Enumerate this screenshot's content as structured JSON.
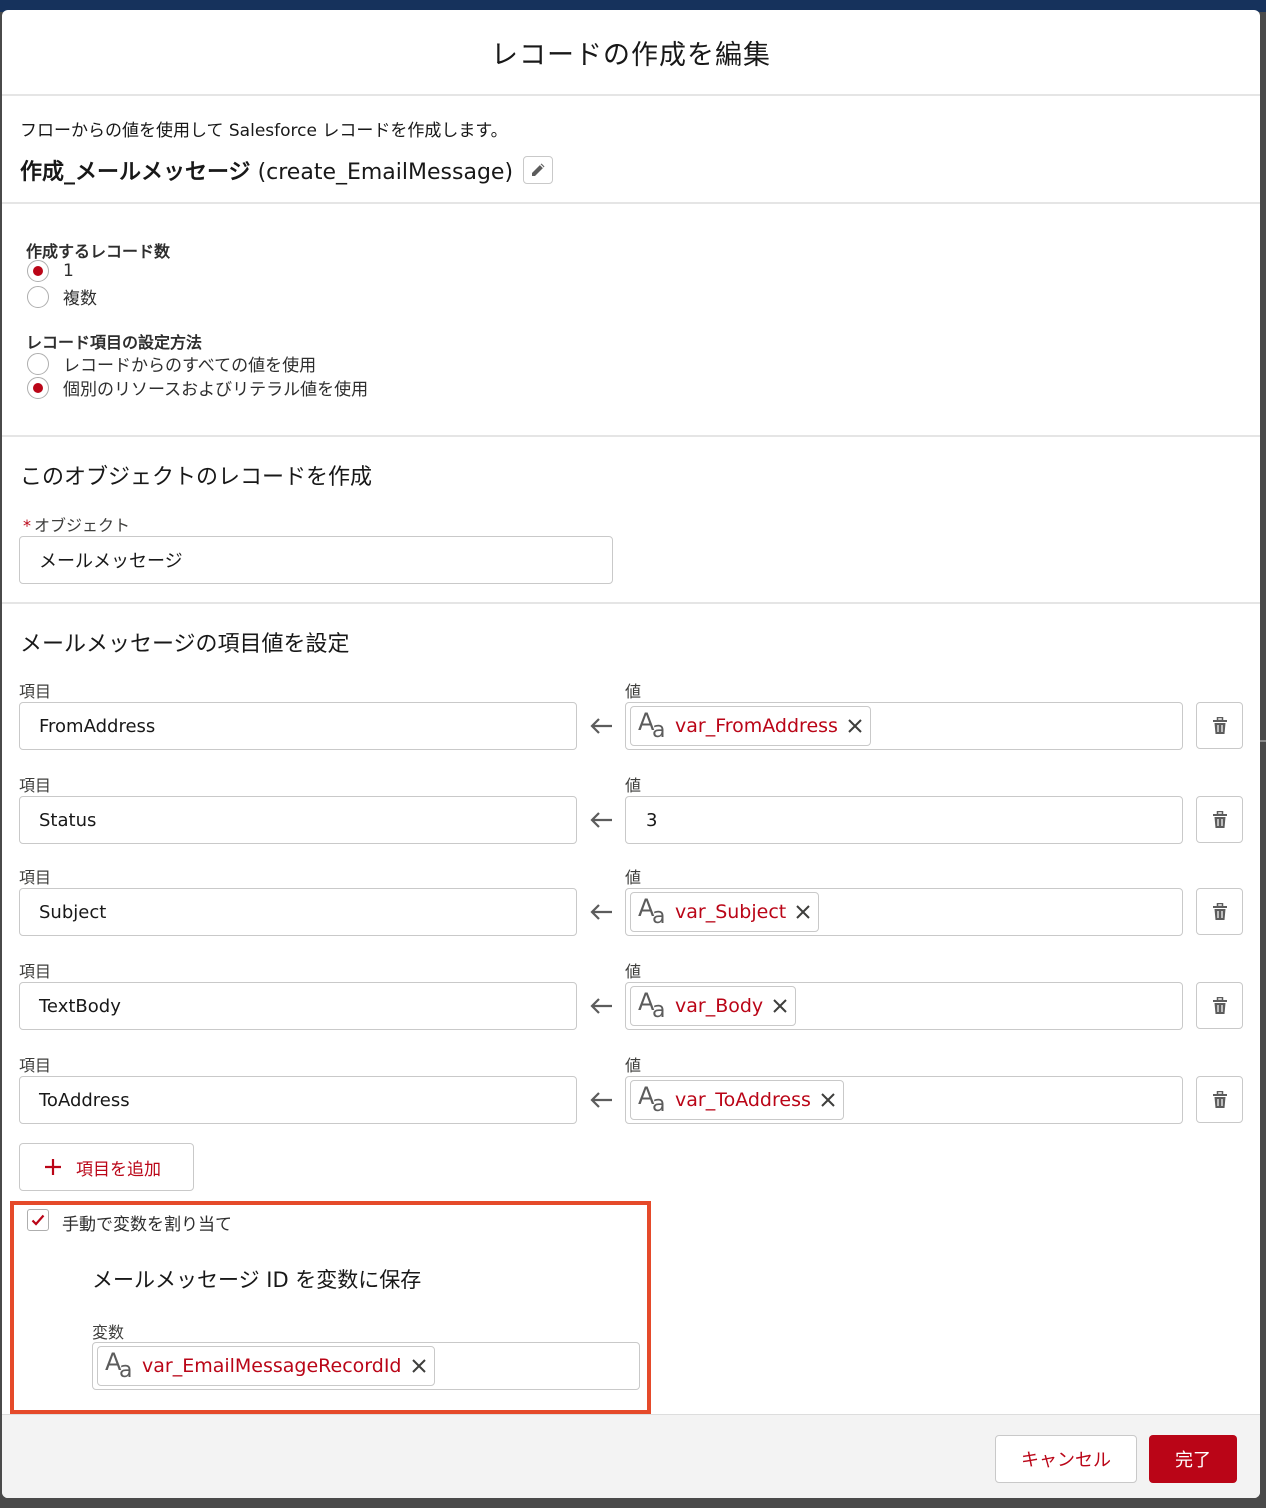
{
  "modal": {
    "title": "レコードの作成を編集"
  },
  "description": {
    "text": "フローからの値を使用して Salesforce レコードを作成します。",
    "element_label": "作成_メールメッセージ",
    "api_name": "(create_EmailMessage)"
  },
  "record_count": {
    "label": "作成するレコード数",
    "options": [
      {
        "label": "1",
        "checked": true
      },
      {
        "label": "複数",
        "checked": false
      }
    ]
  },
  "field_method": {
    "label": "レコード項目の設定方法",
    "options": [
      {
        "label": "レコードからのすべての値を使用",
        "checked": false
      },
      {
        "label": "個別のリソースおよびリテラル値を使用",
        "checked": true
      }
    ]
  },
  "object_section": {
    "heading": "このオブジェクトのレコードを作成",
    "required_mark": "*",
    "object_label": "オブジェクト",
    "object_value": "メールメッセージ"
  },
  "values_section": {
    "heading": "メールメッセージの項目値を設定",
    "field_label": "項目",
    "value_label": "値",
    "rows": [
      {
        "field": "FromAddress",
        "value": "var_FromAddress",
        "value_type": "resource"
      },
      {
        "field": "Status",
        "value": "3",
        "value_type": "literal"
      },
      {
        "field": "Subject",
        "value": "var_Subject",
        "value_type": "resource"
      },
      {
        "field": "TextBody",
        "value": "var_Body",
        "value_type": "resource"
      },
      {
        "field": "ToAddress",
        "value": "var_ToAddress",
        "value_type": "resource"
      }
    ],
    "add_button_label": "項目を追加"
  },
  "manual_assign": {
    "checkbox_label": "手動で変数を割り当て",
    "checked": true,
    "store_heading": "メールメッセージ ID を変数に保存",
    "variable_label": "変数",
    "variable_value": "var_EmailMessageRecordId"
  },
  "footer": {
    "cancel_label": "キャンセル",
    "done_label": "完了"
  },
  "colors": {
    "brand_red": "#ba0517",
    "highlight_border": "#e54a2a",
    "header_strip": "#16325c"
  },
  "icons": {
    "edit": "pencil-icon",
    "arrow": "arrow-left-icon",
    "resource": "text-resource-icon",
    "remove": "close-icon",
    "delete": "trash-icon",
    "add": "plus-icon",
    "check": "checkmark-icon"
  }
}
